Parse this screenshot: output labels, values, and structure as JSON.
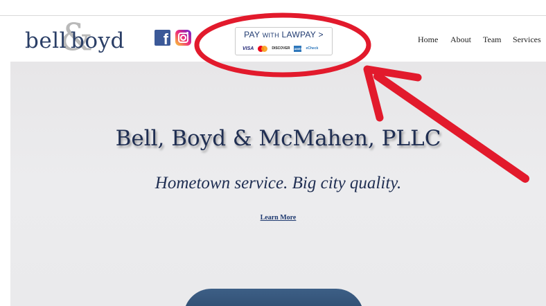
{
  "header": {
    "logo": {
      "word1": "bell",
      "ampersand": "&",
      "word2": "boyd"
    },
    "social": {
      "facebook_glyph": "f",
      "facebook_color": "#3b5998"
    },
    "lawpay": {
      "title_main1": "PAY ",
      "title_small": "WITH",
      "title_main2": " LAWPAY",
      "chevron": ">",
      "cards": {
        "visa": "VISA",
        "discover": "DISCOVER",
        "amex": "AMEX",
        "echeck": "eCheck"
      }
    },
    "nav": [
      "Home",
      "About",
      "Team",
      "Services"
    ]
  },
  "hero": {
    "title": "Bell, Boyd & McMahen, PLLC",
    "subtitle": "Hometown service. Big city quality.",
    "cta": "Learn More"
  },
  "colors": {
    "brand_navy": "#1f2e52",
    "annotation_red": "#e21a2c"
  }
}
